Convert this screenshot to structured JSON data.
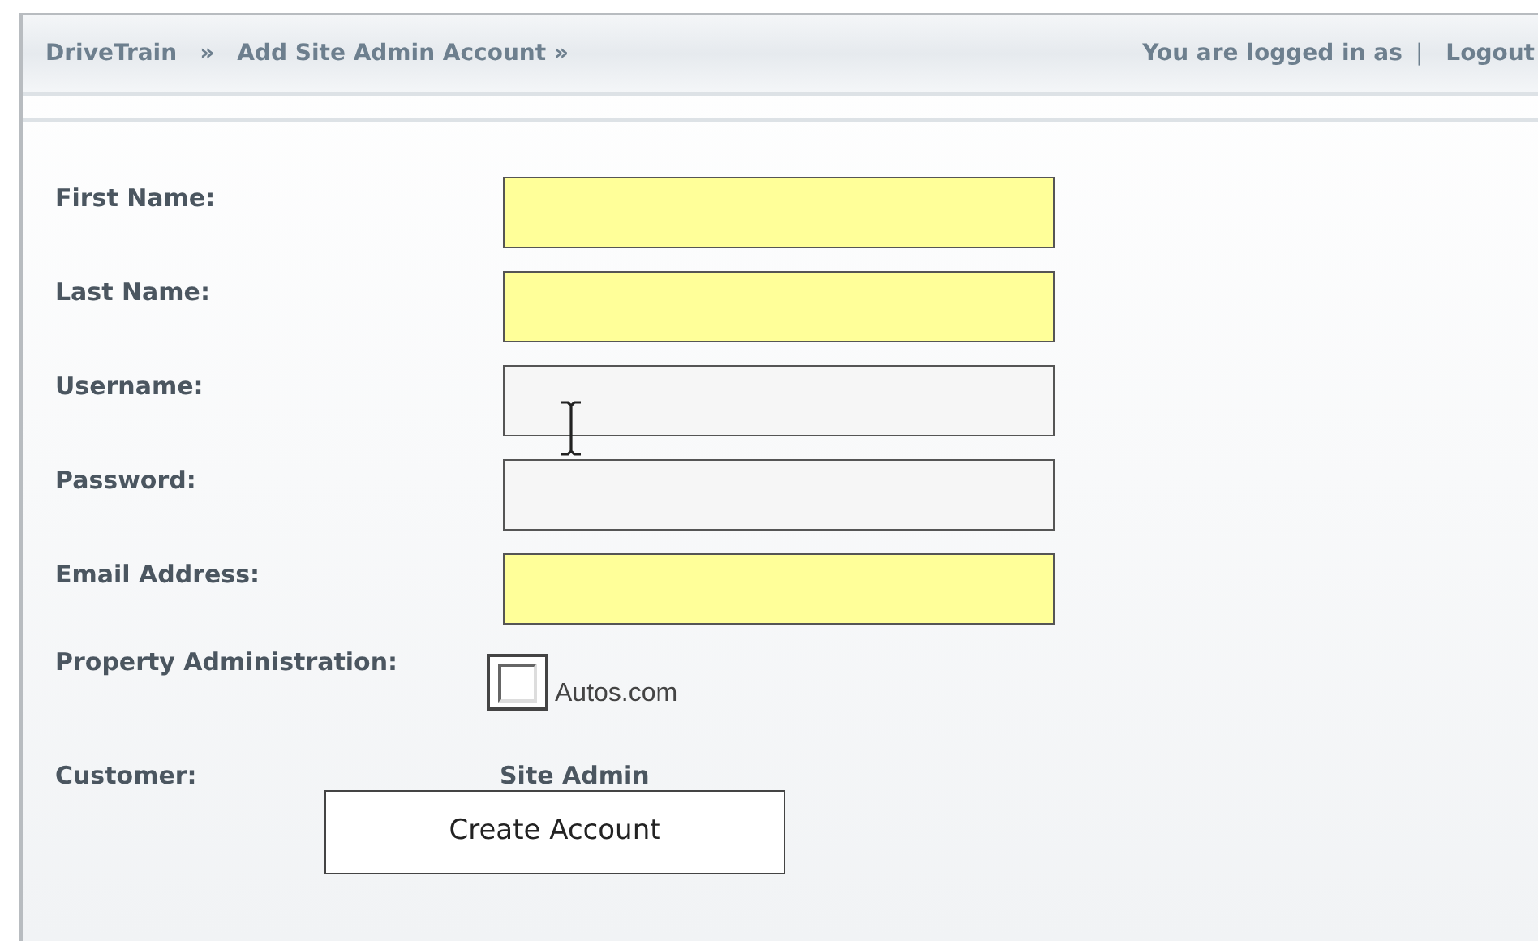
{
  "breadcrumb": {
    "items": [
      "DriveTrain",
      "Add Site Admin Account »"
    ],
    "separator": "»"
  },
  "user_bar": {
    "logged_in": "You are logged in as",
    "divider": "|",
    "logout": "Logout"
  },
  "form": {
    "fields": [
      {
        "label": "First Name:",
        "required": true
      },
      {
        "label": "Last Name:",
        "required": true
      },
      {
        "label": "Username:",
        "required": false
      },
      {
        "label": "Password:",
        "required": false
      },
      {
        "label": "Email Address:",
        "required": true
      }
    ],
    "property_administration": {
      "label": "Property Administration:",
      "option": "Autos.com",
      "checked": false
    },
    "customer": {
      "label": "Customer:",
      "value": "Site Admin"
    },
    "submit": "Create Account"
  }
}
